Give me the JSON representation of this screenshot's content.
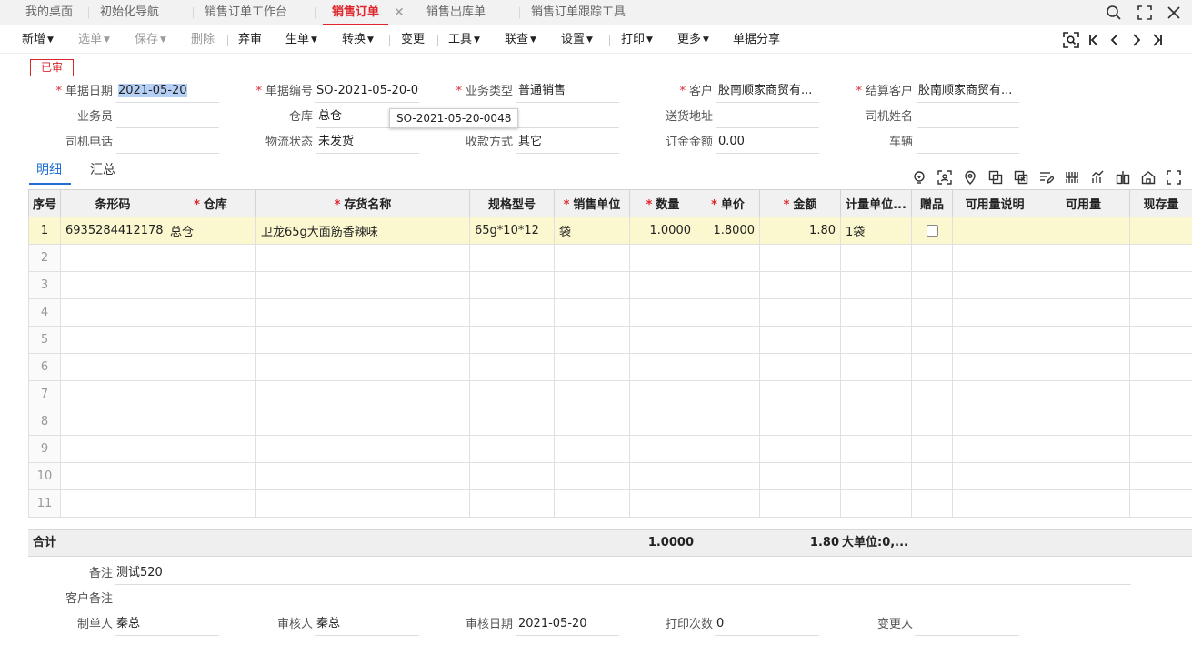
{
  "tabs": [
    {
      "label": "我的桌面",
      "active": false
    },
    {
      "label": "初始化导航",
      "active": false
    },
    {
      "label": "销售订单工作台",
      "active": false
    },
    {
      "label": "销售订单",
      "active": true
    },
    {
      "label": "销售出库单",
      "active": false
    },
    {
      "label": "销售订单跟踪工具",
      "active": false
    }
  ],
  "window_icons": [
    "search-icon",
    "maximize-icon",
    "close-icon"
  ],
  "toolbar": {
    "items": [
      {
        "label": "新增",
        "dropdown": true,
        "disabled": false
      },
      {
        "label": "选单",
        "dropdown": true,
        "disabled": true
      },
      {
        "label": "保存",
        "dropdown": true,
        "disabled": true
      },
      {
        "label": "删除",
        "dropdown": false,
        "disabled": true
      },
      {
        "label": "弃审",
        "dropdown": false,
        "disabled": false
      },
      {
        "label": "生单",
        "dropdown": true,
        "disabled": false
      },
      {
        "label": "转换",
        "dropdown": true,
        "disabled": false
      },
      {
        "label": "变更",
        "dropdown": false,
        "disabled": false
      },
      {
        "label": "工具",
        "dropdown": true,
        "disabled": false
      },
      {
        "label": "联查",
        "dropdown": true,
        "disabled": false
      },
      {
        "label": "设置",
        "dropdown": true,
        "disabled": false
      },
      {
        "label": "打印",
        "dropdown": true,
        "disabled": false
      },
      {
        "label": "更多",
        "dropdown": true,
        "disabled": false
      },
      {
        "label": "单据分享",
        "dropdown": false,
        "disabled": false
      }
    ],
    "nav_icons": [
      "locate-record-icon",
      "first-record-icon",
      "prev-record-icon",
      "next-record-icon",
      "last-record-icon"
    ]
  },
  "status_stamp": "已审",
  "form": {
    "doc_date": {
      "label": "单据日期",
      "value": "2021-05-20",
      "required": true
    },
    "doc_no": {
      "label": "单据编号",
      "value": "SO-2021-05-20-00...",
      "required": true
    },
    "biz_type": {
      "label": "业务类型",
      "value": "普通销售",
      "required": true
    },
    "customer": {
      "label": "客户",
      "value": "胶南顺家商贸有...",
      "required": true
    },
    "settle_customer": {
      "label": "结算客户",
      "value": "胶南顺家商贸有...",
      "required": true
    },
    "salesman": {
      "label": "业务员",
      "value": ""
    },
    "warehouse": {
      "label": "仓库",
      "value": "总仓"
    },
    "dept": {
      "label": "部门",
      "value": ""
    },
    "ship_addr": {
      "label": "送货地址",
      "value": ""
    },
    "driver_name": {
      "label": "司机姓名",
      "value": ""
    },
    "driver_phone": {
      "label": "司机电话",
      "value": ""
    },
    "logistics": {
      "label": "物流状态",
      "value": "未发货"
    },
    "payment": {
      "label": "收款方式",
      "value": "其它"
    },
    "deposit": {
      "label": "订金金额",
      "value": "0.00"
    },
    "vehicle": {
      "label": "车辆",
      "value": ""
    }
  },
  "tooltip": "SO-2021-05-20-0048",
  "subtabs": [
    {
      "label": "明细",
      "active": true
    },
    {
      "label": "汇总",
      "active": false
    }
  ],
  "grid_icons": [
    "bulb-icon",
    "scan-icon",
    "location-icon",
    "copy-row-icon",
    "delete-row-icon",
    "batch-edit-icon",
    "barcode-icon",
    "chart-icon",
    "split-icon",
    "home-icon",
    "fullscreen-icon"
  ],
  "grid": {
    "columns": [
      {
        "label": "序号",
        "required": false
      },
      {
        "label": "条形码",
        "required": false
      },
      {
        "label": "仓库",
        "required": true
      },
      {
        "label": "存货名称",
        "required": true
      },
      {
        "label": "规格型号",
        "required": false
      },
      {
        "label": "销售单位",
        "required": true
      },
      {
        "label": "数量",
        "required": true
      },
      {
        "label": "单价",
        "required": true
      },
      {
        "label": "金额",
        "required": true
      },
      {
        "label": "计量单位...",
        "required": false
      },
      {
        "label": "赠品",
        "required": false
      },
      {
        "label": "可用量说明",
        "required": false
      },
      {
        "label": "可用量",
        "required": false
      },
      {
        "label": "现存量",
        "required": false
      }
    ],
    "rows": [
      {
        "no": "1",
        "barcode": "6935284412178",
        "warehouse": "总仓",
        "name": "卫龙65g大面筋香辣味",
        "spec": "65g*10*12",
        "unit": "袋",
        "qty": "1.0000",
        "price": "1.8000",
        "amount": "1.80",
        "measure": "1袋",
        "gift": false,
        "avail_desc": "",
        "avail": "",
        "stock": ""
      },
      {
        "no": "2"
      },
      {
        "no": "3"
      },
      {
        "no": "4"
      },
      {
        "no": "5"
      },
      {
        "no": "6"
      },
      {
        "no": "7"
      },
      {
        "no": "8"
      },
      {
        "no": "9"
      },
      {
        "no": "10"
      },
      {
        "no": "11"
      }
    ]
  },
  "totals": {
    "label": "合计",
    "qty": "1.0000",
    "amount": "1.80",
    "measure": "大单位:0,..."
  },
  "footer": {
    "remark": {
      "label": "备注",
      "value": "测试520"
    },
    "customer_remark": {
      "label": "客户备注",
      "value": ""
    },
    "creator": {
      "label": "制单人",
      "value": "秦总"
    },
    "auditor": {
      "label": "审核人",
      "value": "秦总"
    },
    "audit_date": {
      "label": "审核日期",
      "value": "2021-05-20"
    },
    "print_count": {
      "label": "打印次数",
      "value": "0"
    },
    "changer": {
      "label": "变更人",
      "value": ""
    }
  },
  "colors": {
    "accent_red": "#e0252b",
    "accent_blue": "#1f6fd1",
    "row_highlight": "#fbf7cf"
  }
}
